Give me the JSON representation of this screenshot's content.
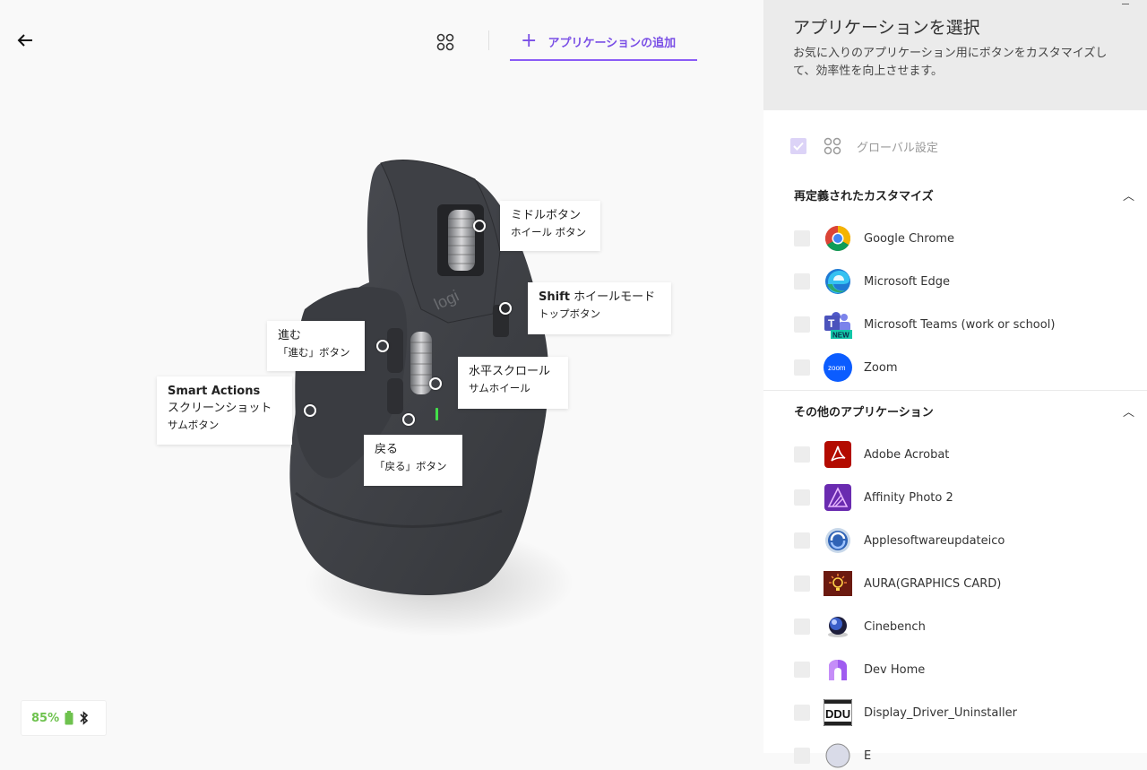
{
  "header": {
    "add_app_label": "アプリケーションの追加"
  },
  "callouts": {
    "middle_title": "ミドルボタン",
    "middle_sub": "ホイール ボタン",
    "shift_bold": "Shift",
    "shift_title": " ホイールモード",
    "shift_sub": "トップボタン",
    "forward_title": "進む",
    "forward_sub": "「進む」ボタン",
    "hscroll_title": "水平スクロール",
    "hscroll_sub": "サムホイール",
    "smart_bold": "Smart Actions",
    "smart_title": "スクリーンショット",
    "smart_sub": "サムボタン",
    "back_title": "戻る",
    "back_sub": "「戻る」ボタン"
  },
  "mouse": {
    "logo_text": "logi"
  },
  "status": {
    "battery": "85%"
  },
  "panel": {
    "title": "アプリケーションを選択",
    "description": "お気に入りのアプリケーション用にボタンをカスタマイズして、効率性を向上させます。",
    "global_label": "グローバル設定",
    "sections": {
      "redefined": "再定義されたカスタマイズ",
      "other": "その他のアプリケーション"
    },
    "redefined_apps": [
      {
        "name": "Google Chrome",
        "icon": "chrome-icon"
      },
      {
        "name": "Microsoft Edge",
        "icon": "edge-icon"
      },
      {
        "name": "Microsoft Teams (work or school)",
        "icon": "teams-icon",
        "badge": "NEW"
      },
      {
        "name": "Zoom",
        "icon": "zoom-icon",
        "badge": "zoom"
      }
    ],
    "other_apps": [
      {
        "name": "Adobe Acrobat",
        "icon": "acrobat-icon"
      },
      {
        "name": "Affinity Photo 2",
        "icon": "affinity-photo-icon"
      },
      {
        "name": "Applesoftwareupdateico",
        "icon": "apple-software-update-icon"
      },
      {
        "name": "AURA(GRAPHICS CARD)",
        "icon": "aura-icon"
      },
      {
        "name": "Cinebench",
        "icon": "cinebench-icon"
      },
      {
        "name": "Dev Home",
        "icon": "dev-home-icon"
      },
      {
        "name": "Display_Driver_Uninstaller",
        "icon": "ddu-icon",
        "badge": "DDU"
      },
      {
        "name": "E",
        "icon": "app-icon"
      }
    ]
  },
  "colors": {
    "accent": "#8a5cf6",
    "battery_green": "#6ec24e",
    "panel_head_bg": "#ebebeb"
  }
}
